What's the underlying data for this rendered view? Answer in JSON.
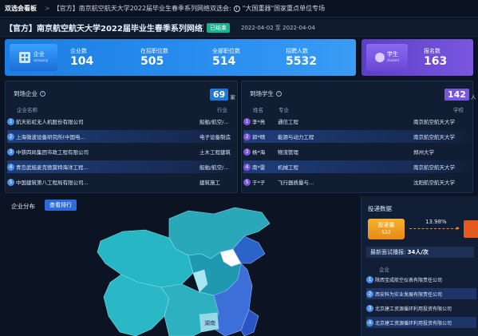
{
  "topbar": {
    "home": "双选会看板",
    "crumb1": "【官方】南京航空航天大学2022届毕业生春季系列网络双选会:",
    "crumb2": "\"大国重器\"国家重点单位专场"
  },
  "title": {
    "text": "【官方】南京航空航天大学2022届毕业生春季系列网络双选...",
    "badge": "已结束",
    "start": "2022-04-02",
    "to": "至",
    "end": "2022-04-04"
  },
  "stats": {
    "enterprise_label": "企业",
    "enterprise_sub": "company",
    "items": [
      {
        "label": "企业数",
        "value": "104"
      },
      {
        "label": "在招职位数",
        "value": "505"
      },
      {
        "label": "全部职位数",
        "value": "514"
      },
      {
        "label": "招聘人数",
        "value": "5532"
      }
    ],
    "student_label": "学生",
    "student_sub": "student",
    "signup_label": "报名数",
    "signup_value": "163"
  },
  "companies": {
    "title": "到场企业",
    "count": "69",
    "unit": "家",
    "col_name": "企业名称",
    "col_industry": "行业",
    "rows": [
      {
        "n": "1",
        "name": "航天彩虹无人机股份有限公司",
        "industry": "船舶/航空/..."
      },
      {
        "n": "2",
        "name": "上海微波设备研究所(中国电...",
        "industry": "电子设备制造"
      },
      {
        "n": "3",
        "name": "中铁四局集团市政工程有限公司",
        "industry": "土木工程建筑"
      },
      {
        "n": "4",
        "name": "青岛武船麦克德莫特海洋工程...",
        "industry": "船舶/航空/..."
      },
      {
        "n": "5",
        "name": "中国建筑第八工程局有限公司...",
        "industry": "建筑施工"
      }
    ]
  },
  "students": {
    "title": "到场学生",
    "count": "142",
    "unit": "人",
    "col_name": "姓名",
    "col_major": "专业",
    "col_school": "学校",
    "rows": [
      {
        "n": "1",
        "name": "李*亮",
        "major": "通信工程",
        "school": "南京航空航天大学"
      },
      {
        "n": "2",
        "name": "郭*晴",
        "major": "能源与动力工程",
        "school": "南京航空航天大学"
      },
      {
        "n": "3",
        "name": "杨*海",
        "major": "物流管理",
        "school": "郑州大学"
      },
      {
        "n": "4",
        "name": "南*雷",
        "major": "机械工程",
        "school": "南京航空航天大学"
      },
      {
        "n": "5",
        "name": "于*子",
        "major": "飞行器质量与...",
        "school": "沈阳航空航天大学"
      }
    ]
  },
  "map": {
    "label": "企业分布",
    "button": "查看排行",
    "region_label": "湖南"
  },
  "delivery": {
    "title": "投递数据",
    "rate_label": "投递量",
    "rate_value": "522",
    "pct": "13.98%",
    "latest_label": "最新面试播报:",
    "latest_value": "34人/次",
    "col": "企业",
    "rows": [
      {
        "n": "1",
        "name": "陕西宝成航空仪表有限责任公司"
      },
      {
        "n": "2",
        "name": "西安科为实业发展有限责任公司"
      },
      {
        "n": "3",
        "name": "北京建工资源循环利用投资有限公司"
      },
      {
        "n": "4",
        "name": "北京建工资源循环利用投资有限公司"
      }
    ]
  }
}
